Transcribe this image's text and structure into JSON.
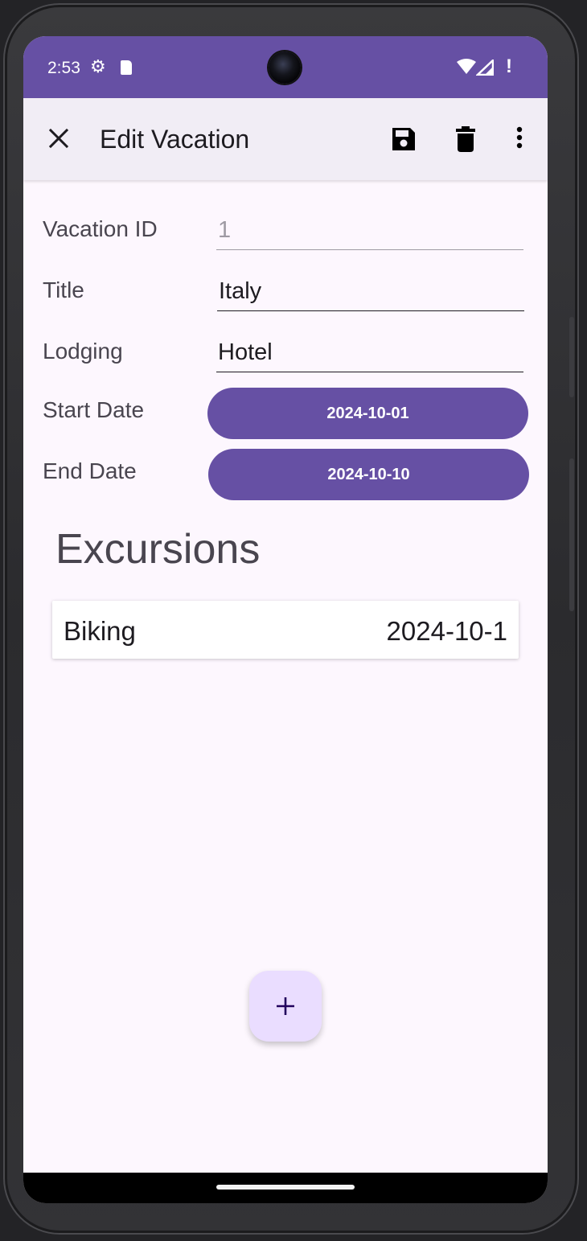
{
  "status_bar": {
    "time": "2:53"
  },
  "app_bar": {
    "title": "Edit Vacation"
  },
  "form": {
    "id_label": "Vacation ID",
    "id_value": "1",
    "title_label": "Title",
    "title_value": "Italy",
    "lodging_label": "Lodging",
    "lodging_value": "Hotel",
    "start_label": "Start Date",
    "start_value": "2024-10-01",
    "end_label": "End Date",
    "end_value": "2024-10-10"
  },
  "excursions": {
    "heading": "Excursions",
    "items": [
      {
        "title": "Biking",
        "date": "2024-10-1"
      }
    ]
  },
  "icons": {
    "close": "close-icon",
    "save": "save-icon",
    "delete": "delete-icon",
    "more": "more-vert-icon",
    "add": "add-icon"
  },
  "colors": {
    "primary": "#6650a4",
    "app_bar_bg": "#f1edf5",
    "surface": "#fdf7fe",
    "fab_bg": "#eaddff",
    "text": "#1d1b20"
  }
}
